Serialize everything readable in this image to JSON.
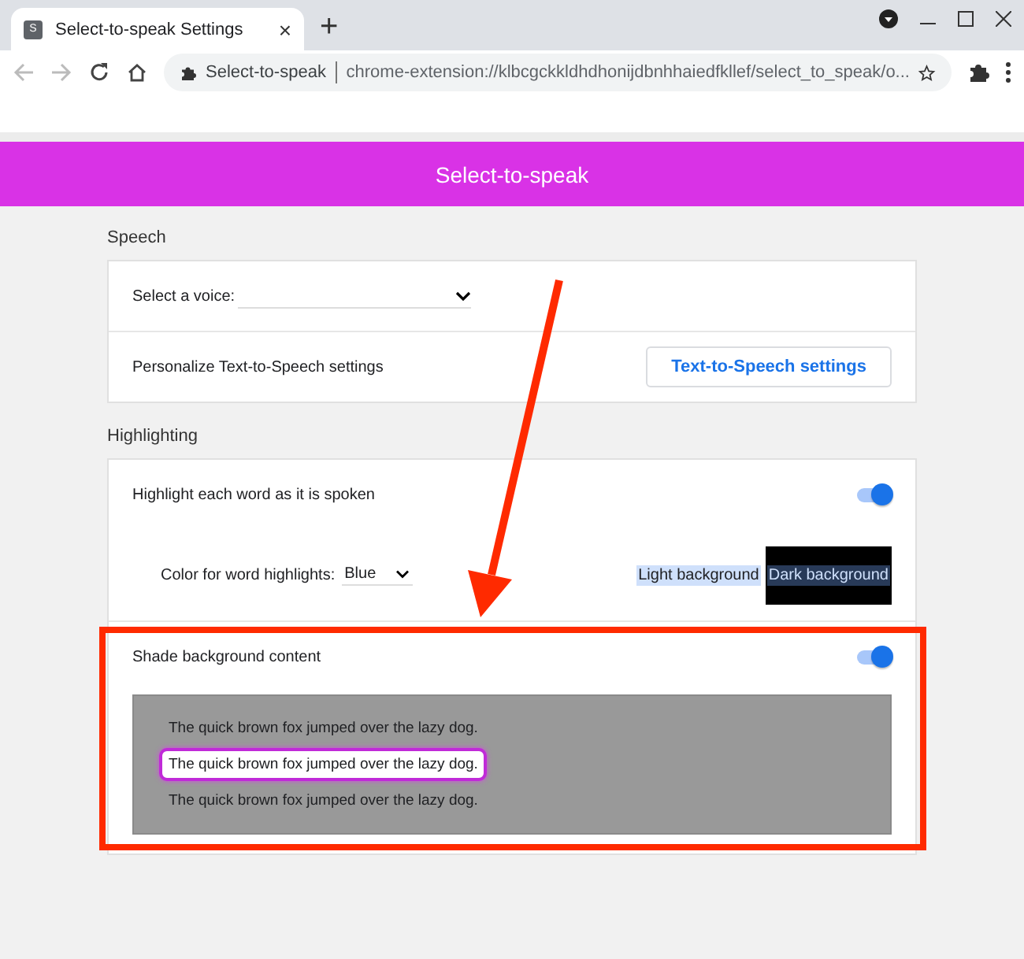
{
  "browser": {
    "tab": {
      "title": "Select-to-speak Settings",
      "favicon": "S",
      "close": "×"
    },
    "new_tab": "+",
    "address": {
      "site": "Select-to-speak",
      "url": "chrome-extension://klbcgckkldhdhonijdbnhhaiedfkllef/select_to_speak/o..."
    }
  },
  "header": {
    "title": "Select-to-speak"
  },
  "sections": [
    {
      "title": "Speech",
      "rows": [
        {
          "kind": "select",
          "label": "Select a voice:"
        },
        {
          "kind": "button",
          "label": "Personalize Text-to-Speech settings",
          "button": "Text-to-Speech settings"
        }
      ]
    },
    {
      "title": "Highlighting",
      "rows": [
        {
          "kind": "toggle",
          "label": "Highlight each word as it is spoken",
          "on": true
        },
        {
          "kind": "color",
          "label": "Color for word highlights:",
          "value": "Blue",
          "previews": [
            {
              "label": "Light background"
            },
            {
              "label": "Dark background"
            }
          ]
        },
        {
          "kind": "toggle",
          "label": "Shade background content",
          "on": true
        },
        {
          "kind": "shade_preview",
          "lines": [
            {
              "text": "The quick brown fox jumped over the lazy dog.",
              "selected": false
            },
            {
              "text": "The quick brown fox jumped over the lazy dog.",
              "selected": true
            },
            {
              "text": "The quick brown fox jumped over the lazy dog.",
              "selected": false
            }
          ]
        }
      ]
    }
  ],
  "annotations": {
    "arrow": true,
    "frame": true
  }
}
